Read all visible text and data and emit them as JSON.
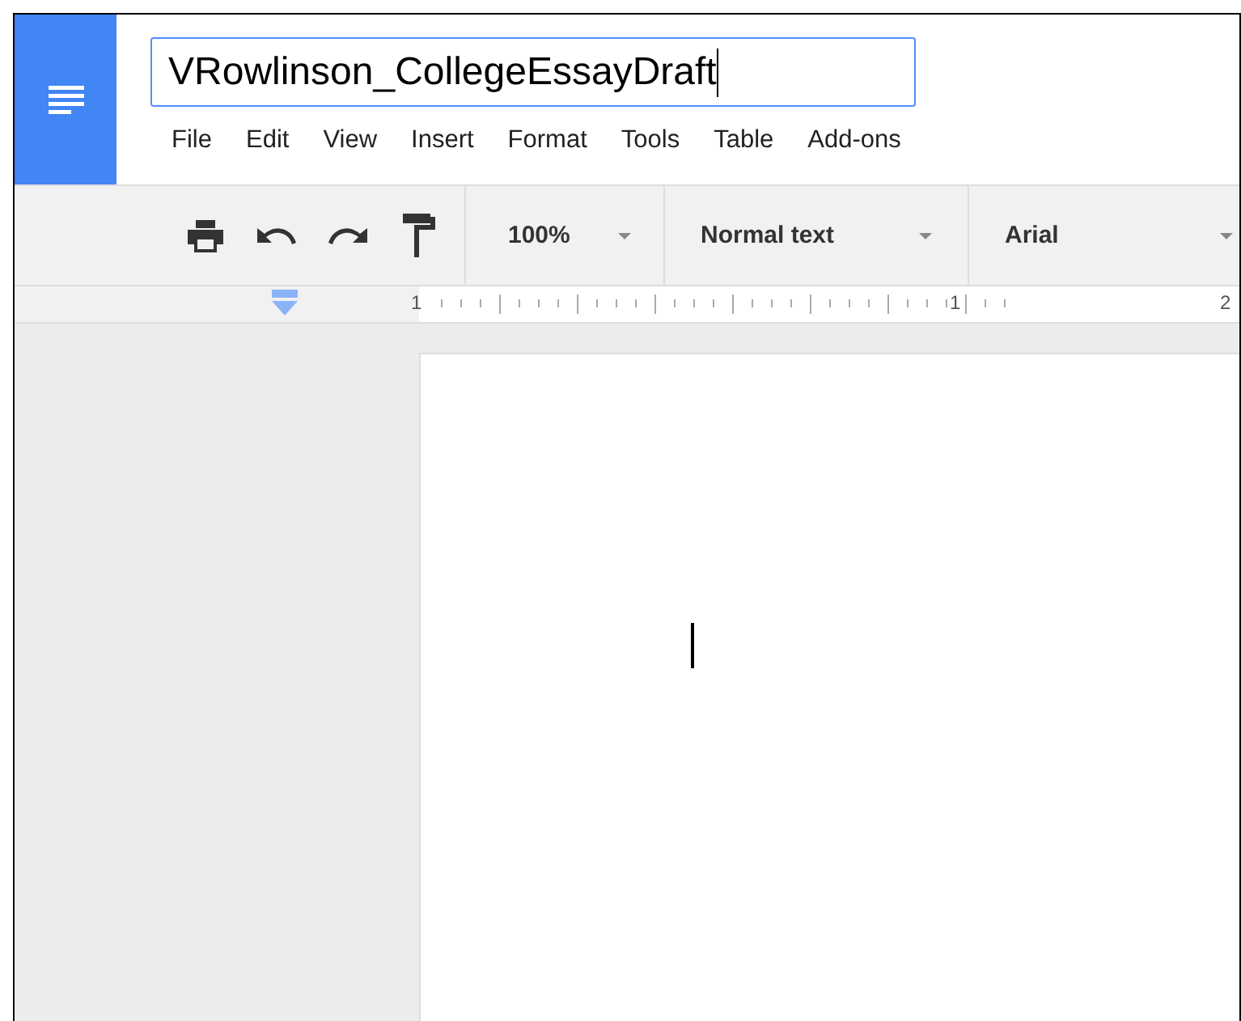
{
  "title_field": {
    "value": "VRowlinson_CollegeEssayDraft"
  },
  "menu": [
    "File",
    "Edit",
    "View",
    "Insert",
    "Format",
    "Tools",
    "Table",
    "Add-ons"
  ],
  "toolbar": {
    "zoom": "100%",
    "style": "Normal text",
    "font": "Arial"
  },
  "ruler": {
    "labels": [
      "1",
      "1",
      "2"
    ]
  }
}
